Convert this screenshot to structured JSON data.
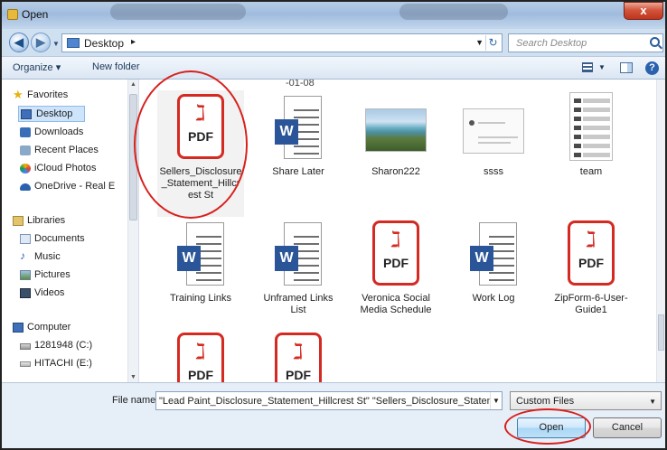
{
  "window": {
    "title": "Open",
    "close_glyph": "x"
  },
  "address": {
    "location": "Desktop",
    "search_placeholder": "Search Desktop"
  },
  "toolbar": {
    "organize": "Organize ▾",
    "new_folder": "New folder",
    "help_glyph": "?"
  },
  "nav": {
    "favorites": [
      {
        "label": "Favorites",
        "icon": "star-icon"
      },
      {
        "label": "Desktop",
        "icon": "desktop-icon"
      },
      {
        "label": "Downloads",
        "icon": "downloads-icon"
      },
      {
        "label": "Recent Places",
        "icon": "recent-places-icon"
      },
      {
        "label": "iCloud Photos",
        "icon": "icloud-photos-icon"
      },
      {
        "label": "OneDrive - Real E",
        "icon": "onedrive-icon"
      }
    ],
    "libraries": [
      {
        "label": "Libraries",
        "icon": "libraries-icon"
      },
      {
        "label": "Documents",
        "icon": "documents-icon"
      },
      {
        "label": "Music",
        "icon": "music-icon"
      },
      {
        "label": "Pictures",
        "icon": "pictures-icon"
      },
      {
        "label": "Videos",
        "icon": "videos-icon"
      }
    ],
    "computer": [
      {
        "label": "Computer",
        "icon": "computer-icon"
      },
      {
        "label": "1281948 (C:)",
        "icon": "drive-icon"
      },
      {
        "label": "HITACHI (E:)",
        "icon": "drive-icon"
      }
    ]
  },
  "files": {
    "cutoff_top": [
      "-01-08"
    ],
    "row1": [
      {
        "name": "Sellers_Disclosure_Statement_Hillcrest St",
        "name_lines": [
          "Sellers_Disclosure",
          "_Statement_Hillcr",
          "est St"
        ],
        "type": "pdf"
      },
      {
        "name": "Share Later",
        "name_lines": [
          "Share Later"
        ],
        "type": "word"
      },
      {
        "name": "Sharon222",
        "name_lines": [
          "Sharon222"
        ],
        "type": "photo"
      },
      {
        "name": "ssss",
        "name_lines": [
          "ssss"
        ],
        "type": "screenshot"
      },
      {
        "name": "team",
        "name_lines": [
          "team"
        ],
        "type": "screenshot-tall"
      }
    ],
    "row2": [
      {
        "name": "Training Links",
        "name_lines": [
          "Training Links"
        ],
        "type": "word"
      },
      {
        "name": "Unframed Links List",
        "name_lines": [
          "Unframed Links",
          "List"
        ],
        "type": "word"
      },
      {
        "name": "Veronica Social Media Schedule",
        "name_lines": [
          "Veronica Social",
          "Media Schedule"
        ],
        "type": "pdf"
      },
      {
        "name": "Work Log",
        "name_lines": [
          "Work Log"
        ],
        "type": "word"
      },
      {
        "name": "ZipForm-6-User-Guide1",
        "name_lines": [
          "ZipForm-6-User-",
          "Guide1"
        ],
        "type": "pdf"
      }
    ],
    "pdf_text": "PDF",
    "word_text": "W",
    "pdf_glyph": "ℷ"
  },
  "footer": {
    "file_name_label": "File name:",
    "file_name_value": "\"Lead Paint_Disclosure_Statement_Hillcrest St\" \"Sellers_Disclosure_Statement_H",
    "file_type": "Custom Files",
    "open_label": "Open",
    "cancel_label": "Cancel"
  },
  "colors": {
    "pdf_red": "#d42a22",
    "word_blue": "#2a5699",
    "annotation_red": "#d8201c",
    "selection": "#cde4fb"
  }
}
